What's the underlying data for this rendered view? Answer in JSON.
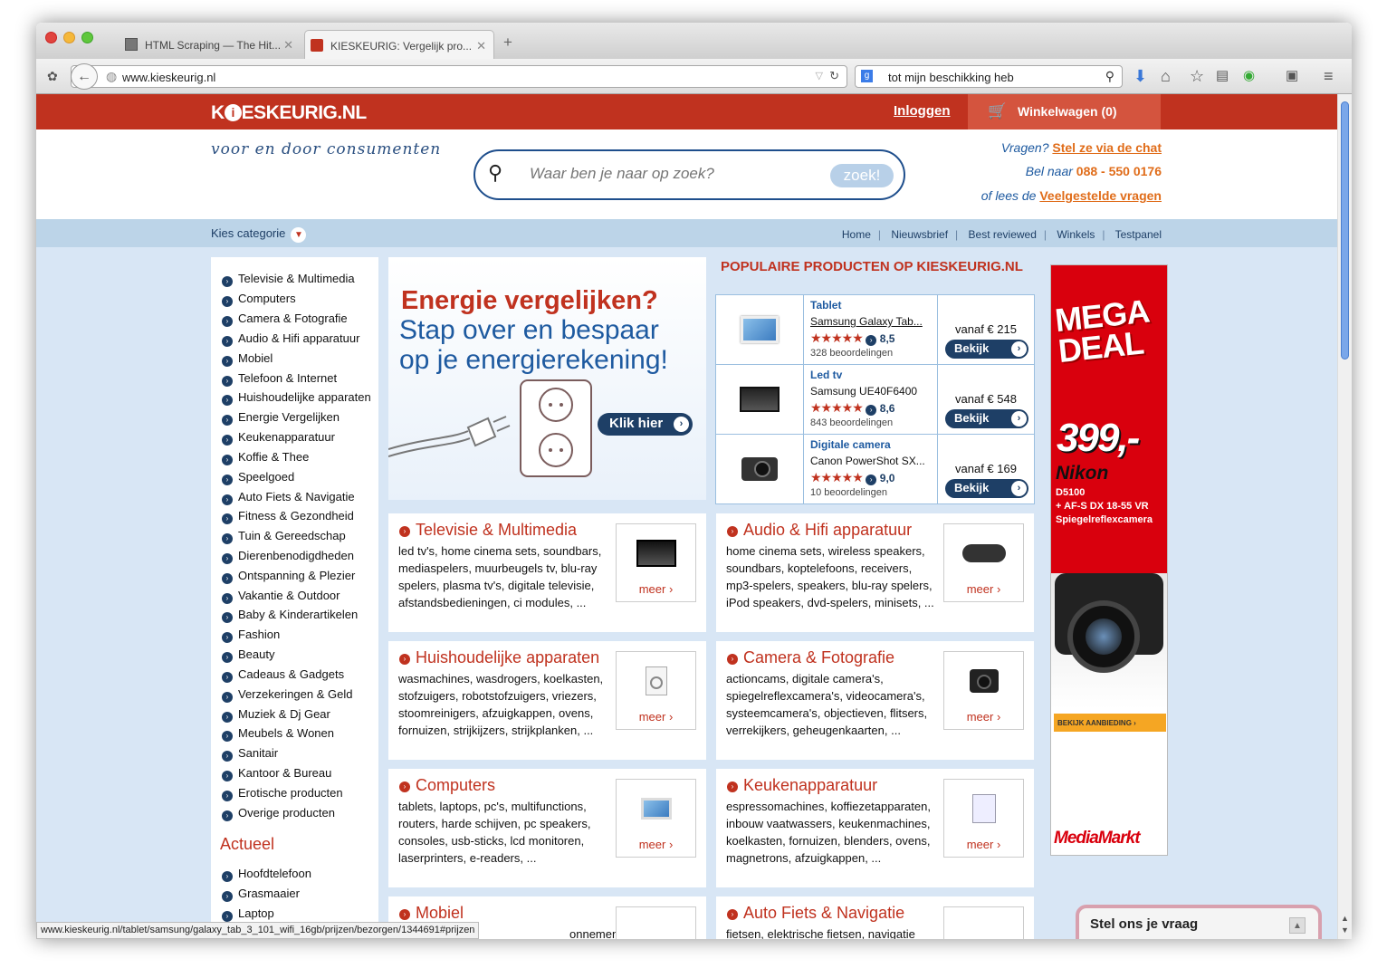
{
  "browser": {
    "tabs": [
      {
        "title": "HTML Scraping — The Hit..."
      },
      {
        "title": "KIESKEURIG: Vergelijk pro..."
      }
    ],
    "url": "www.kieskeurig.nl",
    "search_text": "tot mijn beschikking heb",
    "status_url": "www.kieskeurig.nl/tablet/samsung/galaxy_tab_3_101_wifi_16gb/prijzen/bezorgen/1344691#prijzen"
  },
  "site": {
    "logo": "KIESKEURIG.NL",
    "login": "Inloggen",
    "cart": "Winkelwagen (0)",
    "tagline": "voor en door consumenten",
    "search_placeholder": "Waar ben je naar op zoek?",
    "search_button": "zoek!",
    "contact": {
      "q1": "Vragen?",
      "a1": "Stel ze via de chat",
      "q2": "Bel naar",
      "a2": "088 - 550 0176",
      "q3": "of lees de",
      "a3": "Veelgestelde vragen"
    },
    "kies_categorie": "Kies categorie",
    "top_links": [
      "Home",
      "Nieuwsbrief",
      "Best reviewed",
      "Winkels",
      "Testpanel"
    ]
  },
  "sidebar": {
    "categories": [
      "Televisie & Multimedia",
      "Computers",
      "Camera & Fotografie",
      "Audio & Hifi apparatuur",
      "Mobiel",
      "Telefoon & Internet",
      "Huishoudelijke apparaten",
      "Energie Vergelijken",
      "Keukenapparatuur",
      "Koffie & Thee",
      "Speelgoed",
      "Auto Fiets & Navigatie",
      "Fitness & Gezondheid",
      "Tuin & Gereedschap",
      "Dierenbenodigdheden",
      "Ontspanning & Plezier",
      "Vakantie & Outdoor",
      "Baby & Kinderartikelen",
      "Fashion",
      "Beauty",
      "Cadeaus & Gadgets",
      "Verzekeringen & Geld",
      "Muziek & Dj Gear",
      "Meubels & Wonen",
      "Sanitair",
      "Kantoor & Bureau",
      "Erotische producten",
      "Overige producten"
    ],
    "actueel_title": "Actueel",
    "actueel": [
      "Hoofdtelefoon",
      "Grasmaaier",
      "Laptop"
    ]
  },
  "banner": {
    "title": "Energie vergelijken?",
    "line1": "Stap over en bespaar",
    "line2": "op je energierekening!",
    "button": "Klik hier"
  },
  "popular": {
    "heading": "POPULAIRE PRODUCTEN OP KIESKEURIG.NL",
    "items": [
      {
        "category": "Tablet",
        "name": "Samsung Galaxy Tab...",
        "stars": "★★★★★",
        "score": "8,5",
        "reviews": "328 beoordelingen",
        "price": "vanaf € 215",
        "button": "Bekijk"
      },
      {
        "category": "Led tv",
        "name": "Samsung UE40F6400",
        "stars": "★★★★★",
        "score": "8,6",
        "reviews": "843 beoordelingen",
        "price": "vanaf € 548",
        "button": "Bekijk"
      },
      {
        "category": "Digitale camera",
        "name": "Canon PowerShot SX...",
        "stars": "★★★★★",
        "score": "9,0",
        "reviews": "10 beoordelingen",
        "price": "vanaf € 169",
        "button": "Bekijk"
      }
    ]
  },
  "category_boxes": [
    {
      "title": "Televisie & Multimedia",
      "desc": "led tv's, home cinema sets, soundbars, mediaspelers, muurbeugels tv, blu-ray spelers, plasma tv's, digitale televisie, afstandsbedieningen, ci modules, ...",
      "more": "meer ›"
    },
    {
      "title": "Audio & Hifi apparatuur",
      "desc": "home cinema sets, wireless speakers, soundbars, koptelefoons, receivers, mp3-spelers, speakers, blu-ray spelers, iPod speakers, dvd-spelers, minisets, ...",
      "more": "meer ›"
    },
    {
      "title": "Huishoudelijke apparaten",
      "desc": "wasmachines, wasdrogers, koelkasten, stofzuigers, robotstofzuigers, vriezers, stoomreinigers, afzuigkappen, ovens, fornuizen, strijkijzers, strijkplanken, ...",
      "more": "meer ›"
    },
    {
      "title": "Camera & Fotografie",
      "desc": "actioncams, digitale camera's, spiegelreflexcamera's, videocamera's, systeemcamera's, objectieven, flitsers, verrekijkers, geheugenkaarten, ...",
      "more": "meer ›"
    },
    {
      "title": "Computers",
      "desc": "tablets, laptops, pc's, multifunctions, routers, harde schijven, pc speakers, consoles, usb-sticks, lcd monitoren, laserprinters, e-readers, ...",
      "more": "meer ›"
    },
    {
      "title": "Keukenapparatuur",
      "desc": "espressomachines, koffiezetapparaten, inbouw vaatwassers, keukenmachines, koelkasten, fornuizen, blenders, ovens, magnetrons, afzuigkappen, ...",
      "more": "meer ›"
    },
    {
      "title": "Mobiel",
      "desc": "onnementen,",
      "more": ""
    },
    {
      "title": "Auto Fiets & Navigatie",
      "desc": "fietsen, elektrische fietsen, navigatie",
      "more": ""
    }
  ],
  "ad": {
    "headline": "MEGA DEAL",
    "price": "399,-",
    "brand": "Nikon",
    "model_1": "D5100",
    "model_2": "+ AF-S DX 18-55 VR",
    "model_3": "Spiegelreflexcamera",
    "cta": "BEKIJK AANBIEDING",
    "store": "MediaMarkt"
  },
  "chat": {
    "label": "Stel ons je vraag"
  }
}
